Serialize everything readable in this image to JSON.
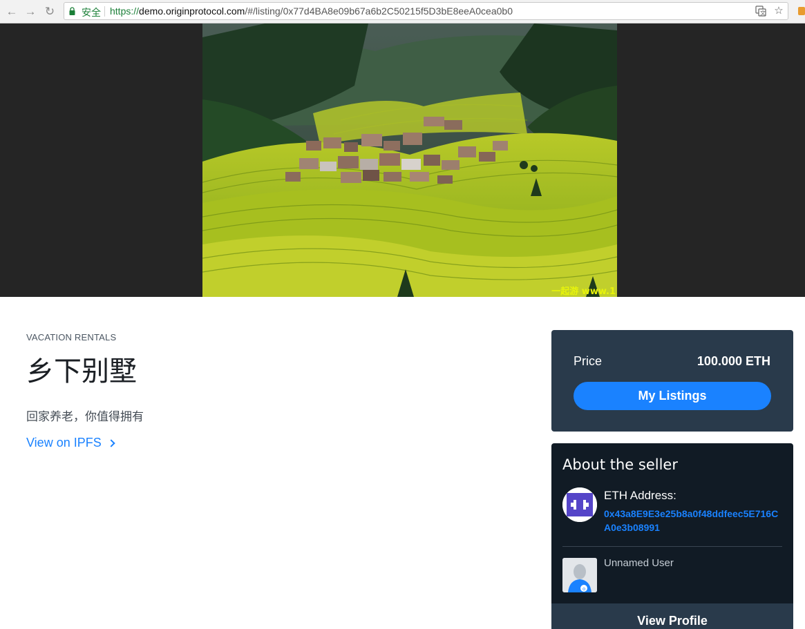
{
  "browser": {
    "secure_label": "安全",
    "url_protocol": "https://",
    "url_host": "demo.originprotocol.com",
    "url_path": "/#/listing/0x77d4BA8e09b67a6b2C50215f5D3bE8eeA0cea0b0"
  },
  "hero": {
    "watermark": "一起游 www.1"
  },
  "listing": {
    "category": "VACATION RENTALS",
    "title": "乡下别墅",
    "description": "回家养老，你值得拥有",
    "ipfs_link": "View on IPFS"
  },
  "price_box": {
    "label": "Price",
    "value": "100.000 ETH",
    "button": "My Listings"
  },
  "seller": {
    "heading": "About the seller",
    "eth_label": "ETH Address:",
    "eth_address": "0x43a8E9E3e25b8a0f48ddfeec5E716CA0e3b08991",
    "user_name": "Unnamed User",
    "view_profile": "View Profile"
  },
  "colors": {
    "accent": "#1a82ff",
    "price_bg": "#293a4b",
    "seller_bg": "#111b25"
  }
}
